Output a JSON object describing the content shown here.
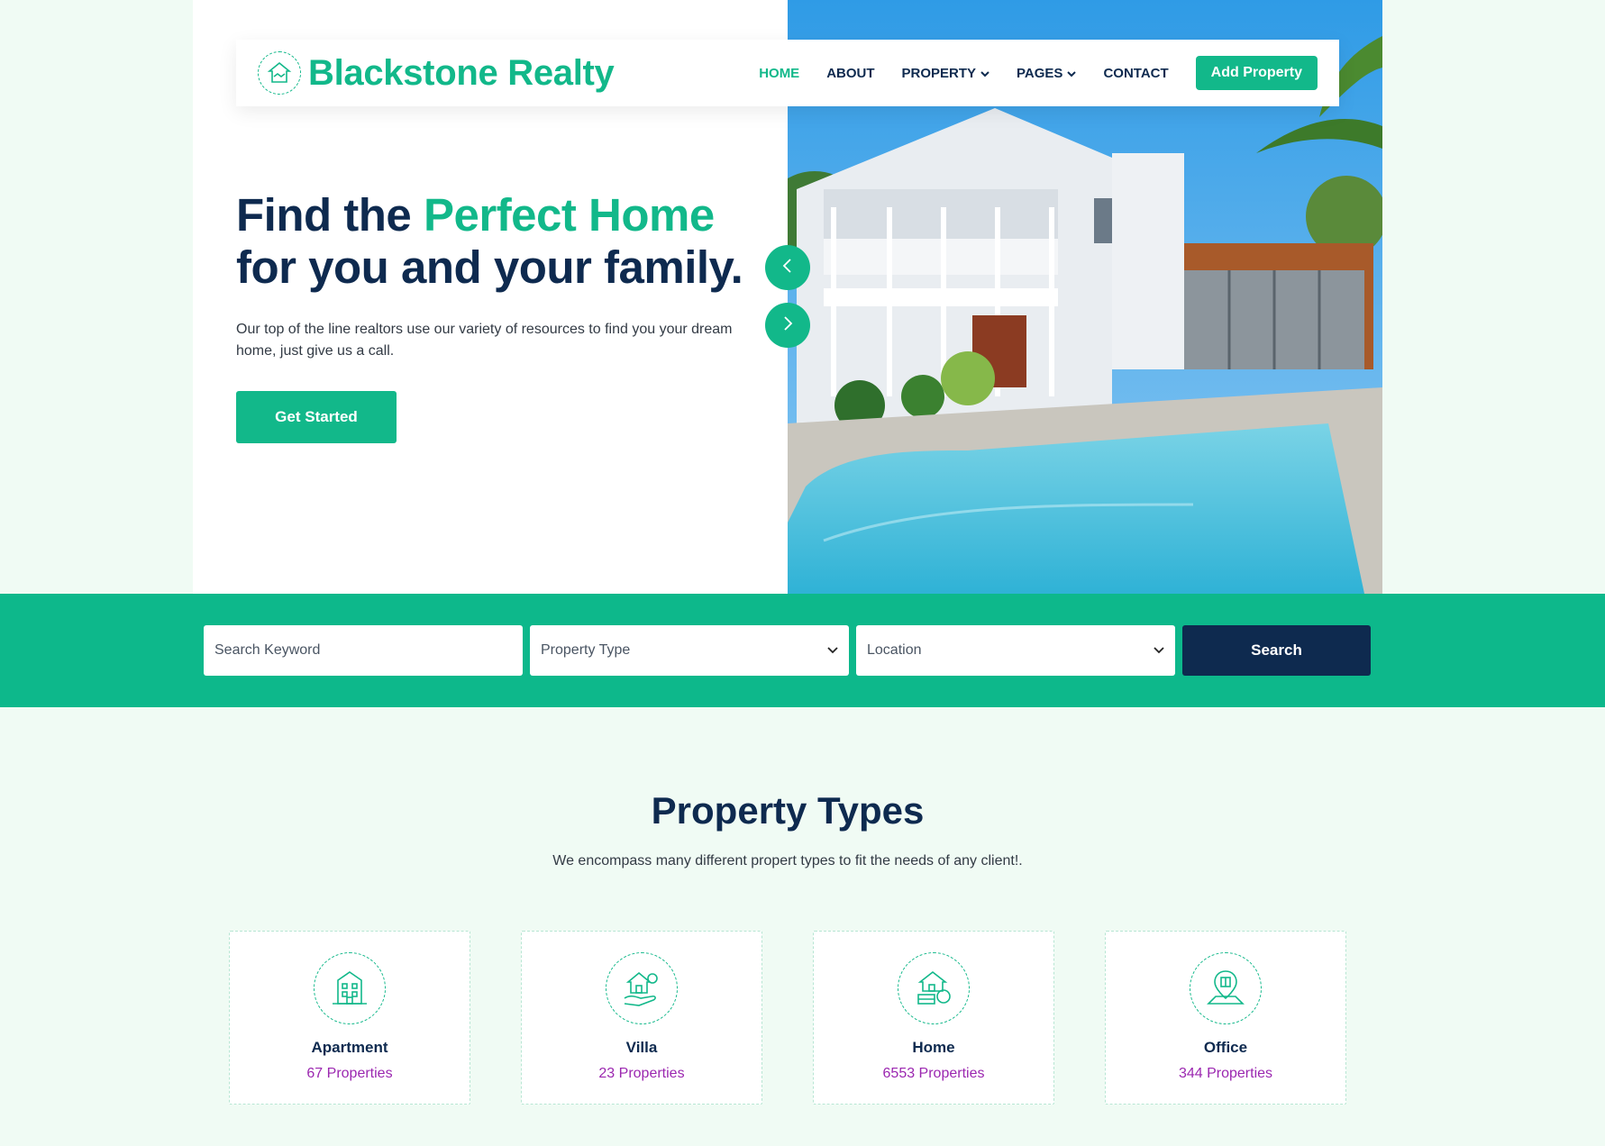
{
  "brand": {
    "name": "Blackstone Realty",
    "color": "#12b88a"
  },
  "nav": {
    "items": [
      {
        "label": "HOME",
        "active": true,
        "dropdown": false
      },
      {
        "label": "ABOUT",
        "active": false,
        "dropdown": false
      },
      {
        "label": "PROPERTY",
        "active": false,
        "dropdown": true
      },
      {
        "label": "PAGES",
        "active": false,
        "dropdown": true
      },
      {
        "label": "CONTACT",
        "active": false,
        "dropdown": false
      }
    ],
    "cta_label": "Add Property"
  },
  "hero": {
    "title_part1": "Find the ",
    "title_accent": "Perfect Home",
    "title_part2": "for you and your family.",
    "description": "Our top of the line realtors use our variety of resources to find you your dream home, just give us a call.",
    "button_label": "Get Started"
  },
  "search": {
    "keyword_placeholder": "Search Keyword",
    "property_type_value": "Property Type",
    "location_value": "Location",
    "button_label": "Search"
  },
  "property_types": {
    "title": "Property Types",
    "subtitle": "We encompass many different propert types to fit the needs of any client!.",
    "items": [
      {
        "name": "Apartment",
        "count": "67 Properties",
        "icon": "apartment-building-icon"
      },
      {
        "name": "Villa",
        "count": "23 Properties",
        "icon": "villa-hand-icon"
      },
      {
        "name": "Home",
        "count": "6553 Properties",
        "icon": "home-money-icon"
      },
      {
        "name": "Office",
        "count": "344 Properties",
        "icon": "office-location-icon"
      }
    ]
  },
  "colors": {
    "accent": "#12b88a",
    "navy": "#0e2a4f",
    "count_purple": "#9b27b0",
    "page_bg": "#f0fbf4"
  }
}
